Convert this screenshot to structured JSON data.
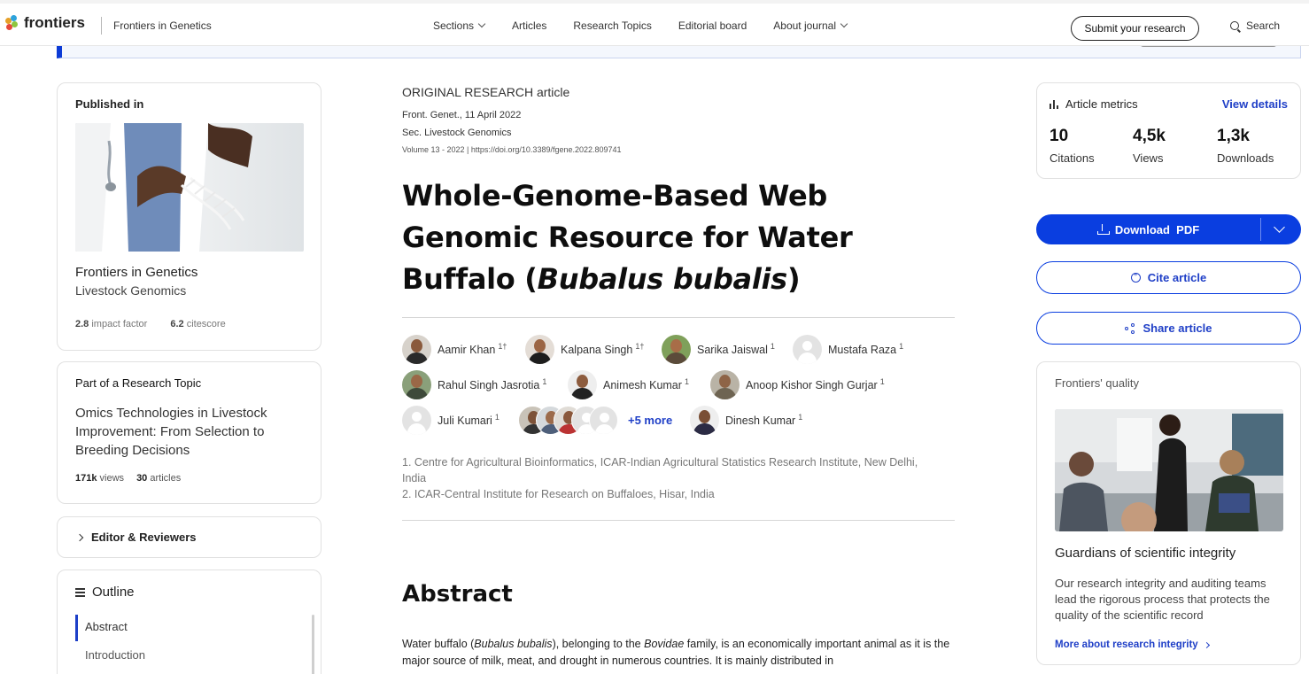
{
  "header": {
    "logo_text": "frontiers",
    "journal": "Frontiers in Genetics",
    "nav": [
      {
        "label": "Sections",
        "dropdown": true
      },
      {
        "label": "Articles",
        "dropdown": false
      },
      {
        "label": "Research Topics",
        "dropdown": false
      },
      {
        "label": "Editorial board",
        "dropdown": false
      },
      {
        "label": "About journal",
        "dropdown": true
      }
    ],
    "submit_label": "Submit your research",
    "search_label": "Search"
  },
  "published_in": {
    "heading": "Published in",
    "journal": "Frontiers in Genetics",
    "section": "Livestock Genomics",
    "impact_value": "2.8",
    "impact_label": "impact factor",
    "citescore_value": "6.2",
    "citescore_label": "citescore"
  },
  "research_topic": {
    "heading": "Part of a Research Topic",
    "title": "Omics Technologies in Livestock Improvement: From Selection to Breeding Decisions",
    "views_value": "171k",
    "views_label": "views",
    "articles_value": "30",
    "articles_label": "articles"
  },
  "editor": {
    "label": "Editor & Reviewers"
  },
  "outline": {
    "heading": "Outline",
    "items": [
      "Abstract",
      "Introduction"
    ]
  },
  "article": {
    "type": "ORIGINAL RESEARCH article",
    "journal_date": "Front. Genet., 11 April 2022",
    "section": "Sec. Livestock Genomics",
    "volume_doi": "Volume 13 - 2022 | https://doi.org/10.3389/fgene.2022.809741",
    "title_plain": "Whole-Genome-Based Web Genomic Resource for Water Buffalo (",
    "title_italic": "Bubalus bubalis",
    "title_close": ")",
    "authors": [
      {
        "name": "Aamir Khan",
        "sup": "1†"
      },
      {
        "name": "Kalpana Singh",
        "sup": "1†"
      },
      {
        "name": "Sarika Jaiswal",
        "sup": "1"
      },
      {
        "name": "Mustafa Raza",
        "sup": "1"
      },
      {
        "name": "Rahul Singh Jasrotia",
        "sup": "1"
      },
      {
        "name": "Animesh Kumar",
        "sup": "1"
      },
      {
        "name": "Anoop Kishor Singh Gurjar",
        "sup": "1"
      },
      {
        "name": "Juli Kumari",
        "sup": "1"
      },
      {
        "name": "Dinesh Kumar",
        "sup": "1"
      }
    ],
    "more_authors": "+5 more",
    "affiliations": [
      "1. Centre for Agricultural Bioinformatics, ICAR-Indian Agricultural Statistics Research Institute, New Delhi, India",
      "2. ICAR-Central Institute for Research on Buffaloes, Hisar, India"
    ],
    "abstract_heading": "Abstract",
    "abstract_p1": "Water buffalo (",
    "abstract_i1": "Bubalus bubalis",
    "abstract_p2": "), belonging to the ",
    "abstract_i2": "Bovidae",
    "abstract_p3": " family, is an economically important animal as it is the major source of milk, meat, and drought in numerous countries. It is mainly distributed in"
  },
  "metrics": {
    "heading": "Article metrics",
    "view_details": "View details",
    "items": [
      {
        "value": "10",
        "label": "Citations"
      },
      {
        "value": "4,5k",
        "label": "Views"
      },
      {
        "value": "1,3k",
        "label": "Downloads"
      }
    ]
  },
  "actions": {
    "download": "Download  PDF",
    "cite": "Cite article",
    "share": "Share article"
  },
  "quality": {
    "heading": "Frontiers' quality",
    "title": "Guardians of scientific integrity",
    "description": "Our research integrity and auditing teams lead the rigorous process that protects the quality of the scientific record",
    "link": "More about research integrity"
  },
  "colors": {
    "accent": "#0a3ee0",
    "link": "#1f3fc7"
  }
}
